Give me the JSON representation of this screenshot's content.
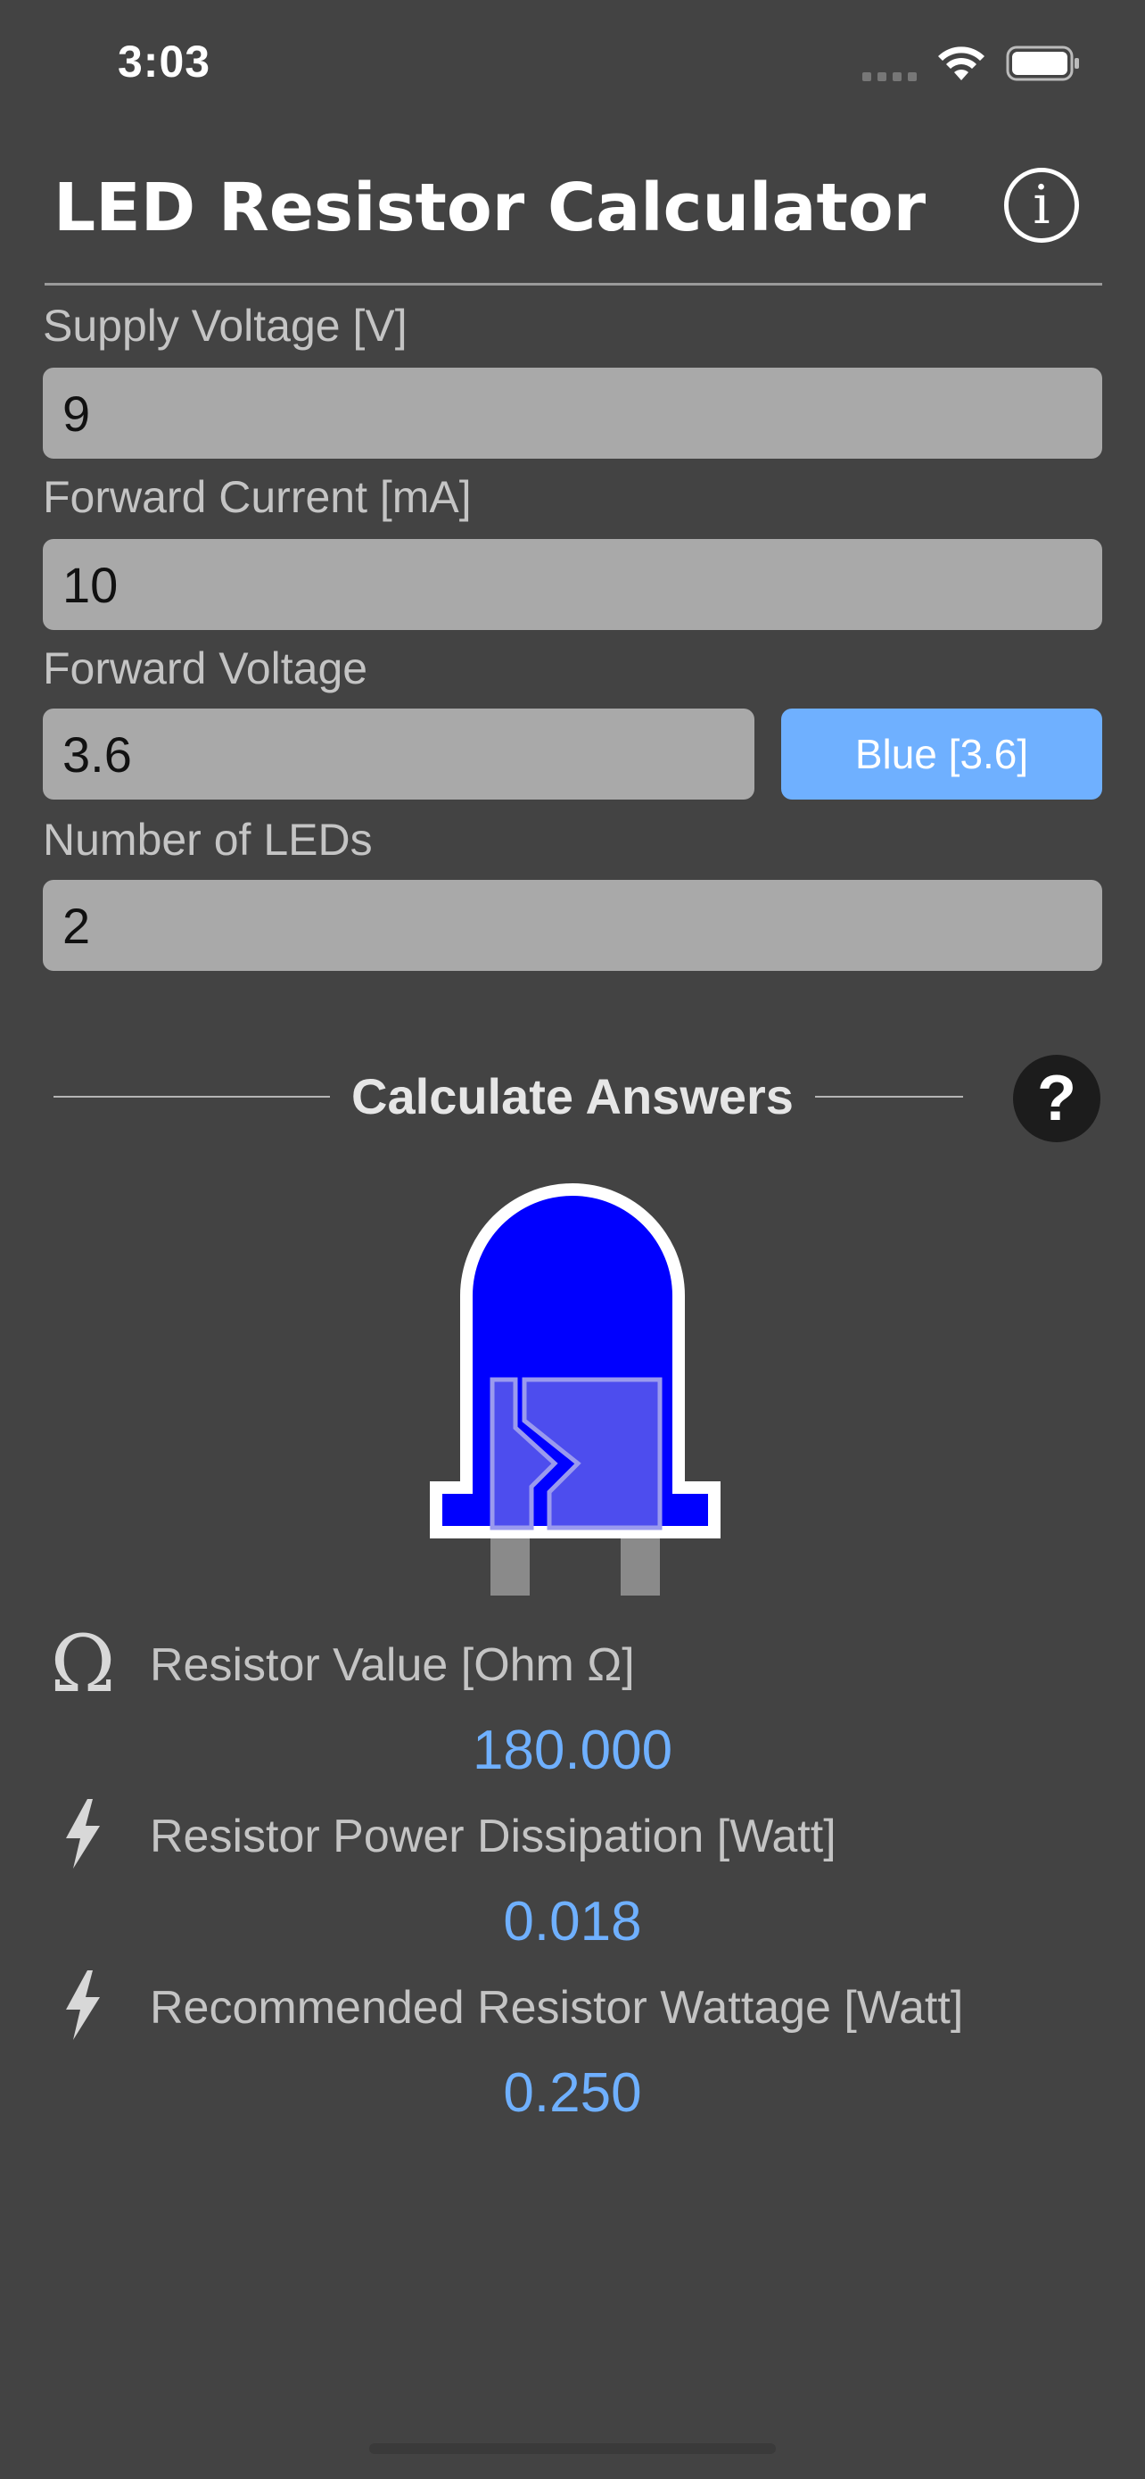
{
  "status": {
    "time": "3:03"
  },
  "header": {
    "title": "LED Resistor Calculator",
    "info_icon": "info-circle-icon"
  },
  "form": {
    "supply_voltage": {
      "label": "Supply Voltage [V]",
      "value": "9"
    },
    "forward_current": {
      "label": "Forward Current [mA]",
      "value": "10"
    },
    "forward_voltage": {
      "label": "Forward Voltage",
      "value": "3.6",
      "preset_button": "Blue [3.6]"
    },
    "num_leds": {
      "label": "Number of LEDs",
      "value": "2"
    }
  },
  "calculate": {
    "title": "Calculate Answers",
    "help_icon": "question-mark-icon"
  },
  "led": {
    "color": "#0000ff",
    "icon": "led-blue-icon"
  },
  "results": {
    "resistor_value": {
      "icon_glyph": "Ω",
      "label": "Resistor Value [Ohm Ω]",
      "value": "180.000"
    },
    "power_dissipation": {
      "label": "Resistor Power Dissipation [Watt]",
      "value": "0.018"
    },
    "recommended_wattage": {
      "label": "Recommended Resistor Wattage [Watt]",
      "value": "0.250"
    }
  },
  "colors": {
    "background": "#434343",
    "accent": "#6fb0ff",
    "input_bg": "#a9a9a9"
  }
}
